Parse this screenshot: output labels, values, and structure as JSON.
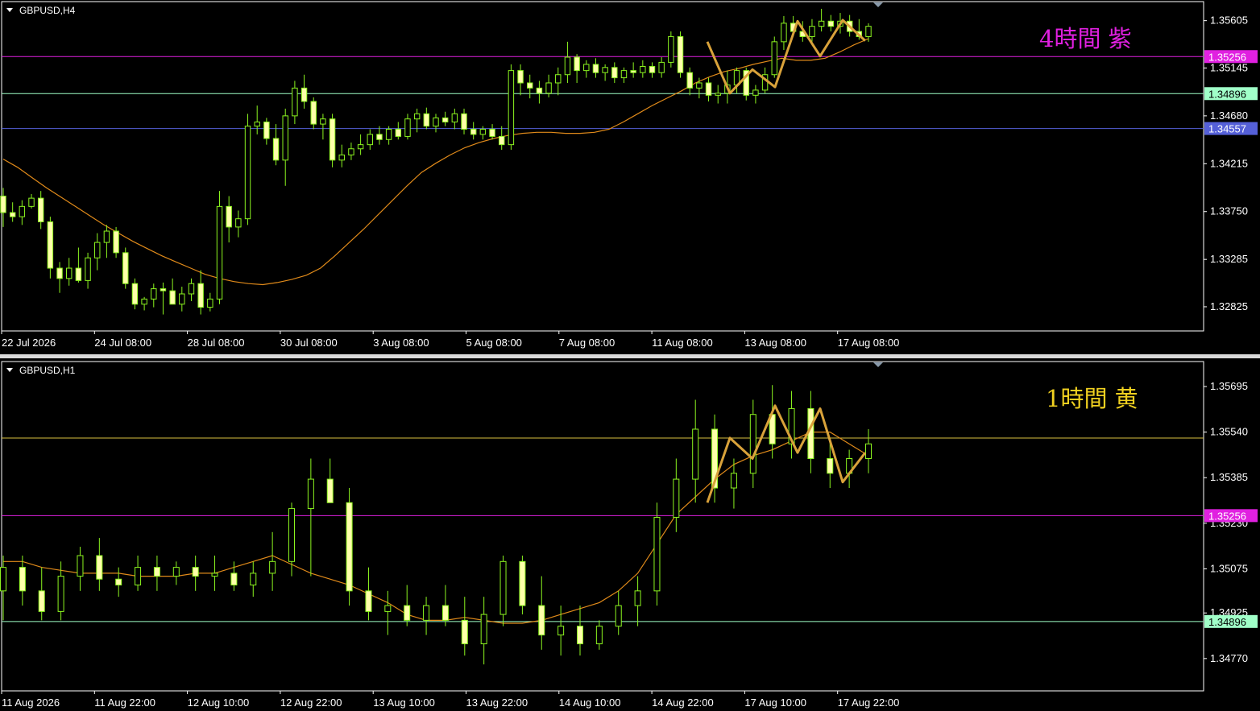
{
  "colors": {
    "background": "#000000",
    "frame": "#ffffff",
    "candle": "#8cf51f",
    "candle_body_up": "#000000",
    "candle_body_down": "#ffffaa",
    "ma_line": "#e08a1a",
    "zigzag": "#d9a23a",
    "purple_line": "#e020e0",
    "green_line": "#a0ffc8",
    "blue_line": "#5560d8",
    "yellow_line": "#d8c040"
  },
  "chart_data": [
    {
      "type": "candlestick",
      "symbol_label": "GBPUSD,H4",
      "annotation": "4時間 紫",
      "annotation_color": "#e020e0",
      "ylim": [
        1.3259,
        1.3579
      ],
      "y_ticks": [
        "1.35605",
        "1.35145",
        "1.34680",
        "1.34215",
        "1.33750",
        "1.33285",
        "1.32825"
      ],
      "x_ticks": [
        "22 Jul 2026",
        "24 Jul 08:00",
        "28 Jul 08:00",
        "30 Jul 08:00",
        "3 Aug 08:00",
        "5 Aug 08:00",
        "7 Aug 08:00",
        "11 Aug 08:00",
        "13 Aug 08:00",
        "17 Aug 08:00"
      ],
      "h_lines": [
        {
          "price": 1.35256,
          "label": "1.35256",
          "color": "#e020e0",
          "tag_color": "#e020e0",
          "text_color": "#ffffff"
        },
        {
          "price": 1.34896,
          "label": "1.34896",
          "color": "#a0ffc8",
          "tag_color": "#a0ffc8",
          "text_color": "#000000"
        },
        {
          "price": 1.34557,
          "label": "1.34557",
          "color": "#5560d8",
          "tag_color": "#5560d8",
          "text_color": "#ffffff"
        }
      ],
      "ma_points": [
        1.3426,
        1.3418,
        1.3408,
        1.3398,
        1.3389,
        1.338,
        1.3371,
        1.3362,
        1.3354,
        1.3346,
        1.3339,
        1.3332,
        1.3326,
        1.332,
        1.3314,
        1.331,
        1.3307,
        1.3305,
        1.3304,
        1.3306,
        1.3309,
        1.3313,
        1.332,
        1.3332,
        1.3345,
        1.3358,
        1.3372,
        1.3386,
        1.34,
        1.3413,
        1.3422,
        1.343,
        1.3437,
        1.3442,
        1.3446,
        1.3449,
        1.3451,
        1.3452,
        1.3452,
        1.3451,
        1.3451,
        1.3452,
        1.3455,
        1.3462,
        1.347,
        1.3478,
        1.3485,
        1.3492,
        1.35,
        1.3506,
        1.3511,
        1.3514,
        1.3518,
        1.3521,
        1.3524,
        1.3522,
        1.3522,
        1.3524,
        1.353,
        1.3537,
        1.3543
      ],
      "zigzag": [
        1.354,
        1.349,
        1.3513,
        1.3496,
        1.356,
        1.3526,
        1.3561,
        1.3541
      ],
      "candles": [
        [
          1.339,
          1.3398,
          1.336,
          1.3374
        ],
        [
          1.3374,
          1.3384,
          1.3365,
          1.337
        ],
        [
          1.337,
          1.3386,
          1.3362,
          1.338
        ],
        [
          1.338,
          1.3392,
          1.3378,
          1.3388
        ],
        [
          1.3388,
          1.3395,
          1.3358,
          1.3365
        ],
        [
          1.3365,
          1.337,
          1.331,
          1.332
        ],
        [
          1.332,
          1.3326,
          1.3296,
          1.331
        ],
        [
          1.331,
          1.333,
          1.3303,
          1.332
        ],
        [
          1.332,
          1.334,
          1.3306,
          1.3308
        ],
        [
          1.3308,
          1.3335,
          1.33,
          1.333
        ],
        [
          1.333,
          1.3354,
          1.3318,
          1.3345
        ],
        [
          1.3345,
          1.3362,
          1.333,
          1.3356
        ],
        [
          1.3356,
          1.336,
          1.333,
          1.3335
        ],
        [
          1.3335,
          1.334,
          1.33,
          1.3305
        ],
        [
          1.3305,
          1.331,
          1.328,
          1.3285
        ],
        [
          1.3285,
          1.3292,
          1.3279,
          1.329
        ],
        [
          1.329,
          1.3305,
          1.3282,
          1.33
        ],
        [
          1.33,
          1.3306,
          1.3275,
          1.3298
        ],
        [
          1.3298,
          1.331,
          1.3288,
          1.3285
        ],
        [
          1.3285,
          1.3302,
          1.3278,
          1.3295
        ],
        [
          1.3295,
          1.331,
          1.3288,
          1.3305
        ],
        [
          1.3305,
          1.3318,
          1.3275,
          1.3282
        ],
        [
          1.3282,
          1.3296,
          1.3278,
          1.329
        ],
        [
          1.329,
          1.3395,
          1.3285,
          1.338
        ],
        [
          1.338,
          1.339,
          1.3345,
          1.336
        ],
        [
          1.336,
          1.3376,
          1.335,
          1.3368
        ],
        [
          1.3368,
          1.347,
          1.3362,
          1.3458
        ],
        [
          1.3458,
          1.3478,
          1.345,
          1.3462
        ],
        [
          1.3462,
          1.3466,
          1.344,
          1.3446
        ],
        [
          1.3446,
          1.346,
          1.342,
          1.3425
        ],
        [
          1.3425,
          1.3475,
          1.34,
          1.3468
        ],
        [
          1.3468,
          1.3502,
          1.346,
          1.3495
        ],
        [
          1.3495,
          1.3508,
          1.3475,
          1.3482
        ],
        [
          1.3482,
          1.3486,
          1.3455,
          1.346
        ],
        [
          1.346,
          1.347,
          1.3445,
          1.3465
        ],
        [
          1.3465,
          1.347,
          1.3418,
          1.3425
        ],
        [
          1.3425,
          1.344,
          1.3418,
          1.343
        ],
        [
          1.343,
          1.3442,
          1.3425,
          1.3436
        ],
        [
          1.3436,
          1.345,
          1.343,
          1.344
        ],
        [
          1.344,
          1.3455,
          1.3435,
          1.345
        ],
        [
          1.345,
          1.3458,
          1.344,
          1.3445
        ],
        [
          1.3445,
          1.3458,
          1.344,
          1.3455
        ],
        [
          1.3455,
          1.3462,
          1.3445,
          1.3448
        ],
        [
          1.3448,
          1.347,
          1.3445,
          1.3465
        ],
        [
          1.3465,
          1.3475,
          1.3452,
          1.347
        ],
        [
          1.347,
          1.3476,
          1.3455,
          1.3458
        ],
        [
          1.3458,
          1.347,
          1.3452,
          1.3466
        ],
        [
          1.3466,
          1.3472,
          1.3458,
          1.3462
        ],
        [
          1.3462,
          1.3475,
          1.3455,
          1.347
        ],
        [
          1.347,
          1.3475,
          1.345,
          1.3455
        ],
        [
          1.3455,
          1.3462,
          1.3445,
          1.345
        ],
        [
          1.345,
          1.3458,
          1.3445,
          1.3455
        ],
        [
          1.3455,
          1.346,
          1.3445,
          1.3448
        ],
        [
          1.3448,
          1.3458,
          1.3435,
          1.344
        ],
        [
          1.344,
          1.3518,
          1.3435,
          1.3512
        ],
        [
          1.3512,
          1.3518,
          1.3488,
          1.35
        ],
        [
          1.35,
          1.3508,
          1.3485,
          1.3495
        ],
        [
          1.3495,
          1.3502,
          1.348,
          1.349
        ],
        [
          1.349,
          1.3508,
          1.3486,
          1.35
        ],
        [
          1.35,
          1.3515,
          1.3488,
          1.3508
        ],
        [
          1.3508,
          1.354,
          1.35,
          1.3525
        ],
        [
          1.3525,
          1.3528,
          1.35,
          1.3512
        ],
        [
          1.3512,
          1.3522,
          1.3505,
          1.3518
        ],
        [
          1.3518,
          1.3524,
          1.3505,
          1.351
        ],
        [
          1.351,
          1.3518,
          1.3502,
          1.3515
        ],
        [
          1.3515,
          1.352,
          1.35,
          1.3505
        ],
        [
          1.3505,
          1.3515,
          1.35,
          1.3512
        ],
        [
          1.3512,
          1.352,
          1.3505,
          1.351
        ],
        [
          1.351,
          1.3522,
          1.3505,
          1.3516
        ],
        [
          1.3516,
          1.352,
          1.3505,
          1.351
        ],
        [
          1.351,
          1.3525,
          1.3505,
          1.352
        ],
        [
          1.352,
          1.355,
          1.3515,
          1.3545
        ],
        [
          1.3545,
          1.355,
          1.3505,
          1.351
        ],
        [
          1.351,
          1.3515,
          1.3488,
          1.3495
        ],
        [
          1.3495,
          1.3505,
          1.3485,
          1.35
        ],
        [
          1.35,
          1.3505,
          1.3482,
          1.3488
        ],
        [
          1.3488,
          1.3498,
          1.348,
          1.349
        ],
        [
          1.349,
          1.3512,
          1.348,
          1.3498
        ],
        [
          1.3498,
          1.3515,
          1.349,
          1.3512
        ],
        [
          1.3512,
          1.3515,
          1.3483,
          1.3488
        ],
        [
          1.3488,
          1.3498,
          1.348,
          1.3493
        ],
        [
          1.3493,
          1.3515,
          1.349,
          1.3508
        ],
        [
          1.3508,
          1.3545,
          1.3505,
          1.354
        ],
        [
          1.354,
          1.3565,
          1.3532,
          1.3558
        ],
        [
          1.3558,
          1.3565,
          1.3545,
          1.355
        ],
        [
          1.355,
          1.356,
          1.354,
          1.3545
        ],
        [
          1.3545,
          1.3562,
          1.354,
          1.3555
        ],
        [
          1.3555,
          1.3572,
          1.355,
          1.356
        ],
        [
          1.356,
          1.3566,
          1.355,
          1.3555
        ],
        [
          1.3555,
          1.3568,
          1.3548,
          1.356
        ],
        [
          1.356,
          1.3566,
          1.3545,
          1.355
        ],
        [
          1.355,
          1.3562,
          1.3542,
          1.3545
        ],
        [
          1.3545,
          1.3558,
          1.354,
          1.3555
        ]
      ]
    },
    {
      "type": "candlestick",
      "symbol_label": "GBPUSD,H1",
      "annotation": "1時間 黄",
      "annotation_color": "#f0d020",
      "ylim": [
        1.3466,
        1.3578
      ],
      "y_ticks": [
        "1.35695",
        "1.35540",
        "1.35385",
        "1.35230",
        "1.35075",
        "1.34925",
        "1.34770"
      ],
      "x_ticks": [
        "11 Aug 2026",
        "11 Aug 22:00",
        "12 Aug 10:00",
        "12 Aug 22:00",
        "13 Aug 10:00",
        "13 Aug 22:00",
        "14 Aug 10:00",
        "14 Aug 22:00",
        "17 Aug 10:00",
        "17 Aug 22:00"
      ],
      "h_lines": [
        {
          "price": 1.3552,
          "label": "",
          "color": "#d8c040",
          "tag_color": "",
          "text_color": ""
        },
        {
          "price": 1.35256,
          "label": "1.35256",
          "color": "#e020e0",
          "tag_color": "#e020e0",
          "text_color": "#ffffff"
        },
        {
          "price": 1.34896,
          "label": "1.34896",
          "color": "#a0ffc8",
          "tag_color": "#a0ffc8",
          "text_color": "#000000"
        }
      ],
      "ma_points": [
        1.351,
        1.351,
        1.3508,
        1.3507,
        1.3506,
        1.3506,
        1.3506,
        1.3505,
        1.3505,
        1.3505,
        1.3506,
        1.3506,
        1.3508,
        1.351,
        1.3512,
        1.3509,
        1.3506,
        1.3504,
        1.3502,
        1.3499,
        1.3496,
        1.3492,
        1.349,
        1.349,
        1.3491,
        1.349,
        1.3489,
        1.3489,
        1.349,
        1.3492,
        1.3494,
        1.3496,
        1.35,
        1.3506,
        1.3516,
        1.3526,
        1.3532,
        1.3538,
        1.3543,
        1.3546,
        1.3548,
        1.3551,
        1.3554,
        1.3554,
        1.355,
        1.3546
      ],
      "zigzag": [
        1.353,
        1.3552,
        1.3545,
        1.3563,
        1.3547,
        1.3562,
        1.3537,
        1.3547
      ],
      "candles": [
        [
          1.35,
          1.3512,
          1.349,
          1.3508
        ],
        [
          1.3508,
          1.3512,
          1.3495,
          1.35
        ],
        [
          1.35,
          1.3508,
          1.349,
          1.3493
        ],
        [
          1.3493,
          1.351,
          1.349,
          1.3505
        ],
        [
          1.3505,
          1.3515,
          1.35,
          1.3512
        ],
        [
          1.3512,
          1.3518,
          1.35,
          1.3504
        ],
        [
          1.3504,
          1.3508,
          1.3498,
          1.3502
        ],
        [
          1.3502,
          1.3512,
          1.35,
          1.3508
        ],
        [
          1.3508,
          1.3512,
          1.35,
          1.3505
        ],
        [
          1.3505,
          1.351,
          1.3502,
          1.3508
        ],
        [
          1.3508,
          1.3512,
          1.35,
          1.3505
        ],
        [
          1.3505,
          1.3512,
          1.35,
          1.3506
        ],
        [
          1.3506,
          1.351,
          1.35,
          1.3502
        ],
        [
          1.3502,
          1.351,
          1.3498,
          1.3506
        ],
        [
          1.3506,
          1.352,
          1.35,
          1.351
        ],
        [
          1.351,
          1.353,
          1.3505,
          1.3528
        ],
        [
          1.3528,
          1.3545,
          1.3505,
          1.3538
        ],
        [
          1.3538,
          1.3545,
          1.353,
          1.353
        ],
        [
          1.353,
          1.3535,
          1.3495,
          1.35
        ],
        [
          1.35,
          1.3508,
          1.349,
          1.3493
        ],
        [
          1.3493,
          1.35,
          1.3485,
          1.3495
        ],
        [
          1.3495,
          1.3502,
          1.3488,
          1.349
        ],
        [
          1.349,
          1.3498,
          1.3485,
          1.3495
        ],
        [
          1.3495,
          1.3502,
          1.3488,
          1.349
        ],
        [
          1.349,
          1.3498,
          1.3478,
          1.3482
        ],
        [
          1.3482,
          1.3498,
          1.3475,
          1.3492
        ],
        [
          1.3492,
          1.3512,
          1.3488,
          1.351
        ],
        [
          1.351,
          1.3512,
          1.3492,
          1.3495
        ],
        [
          1.3495,
          1.3505,
          1.348,
          1.3485
        ],
        [
          1.3485,
          1.3495,
          1.3478,
          1.3488
        ],
        [
          1.3488,
          1.3495,
          1.3478,
          1.3482
        ],
        [
          1.3482,
          1.349,
          1.348,
          1.3488
        ],
        [
          1.3488,
          1.35,
          1.3485,
          1.3495
        ],
        [
          1.3495,
          1.3505,
          1.3488,
          1.35
        ],
        [
          1.35,
          1.353,
          1.3495,
          1.3525
        ],
        [
          1.3525,
          1.3545,
          1.352,
          1.3538
        ],
        [
          1.3538,
          1.3565,
          1.353,
          1.3555
        ],
        [
          1.3555,
          1.356,
          1.353,
          1.3535
        ],
        [
          1.3535,
          1.3545,
          1.3528,
          1.354
        ],
        [
          1.354,
          1.3565,
          1.3535,
          1.356
        ],
        [
          1.356,
          1.357,
          1.3545,
          1.355
        ],
        [
          1.355,
          1.3568,
          1.3545,
          1.3562
        ],
        [
          1.3562,
          1.3568,
          1.354,
          1.3545
        ],
        [
          1.3545,
          1.3552,
          1.3535,
          1.354
        ],
        [
          1.354,
          1.3548,
          1.3535,
          1.3545
        ],
        [
          1.3545,
          1.3555,
          1.354,
          1.355
        ]
      ]
    }
  ]
}
